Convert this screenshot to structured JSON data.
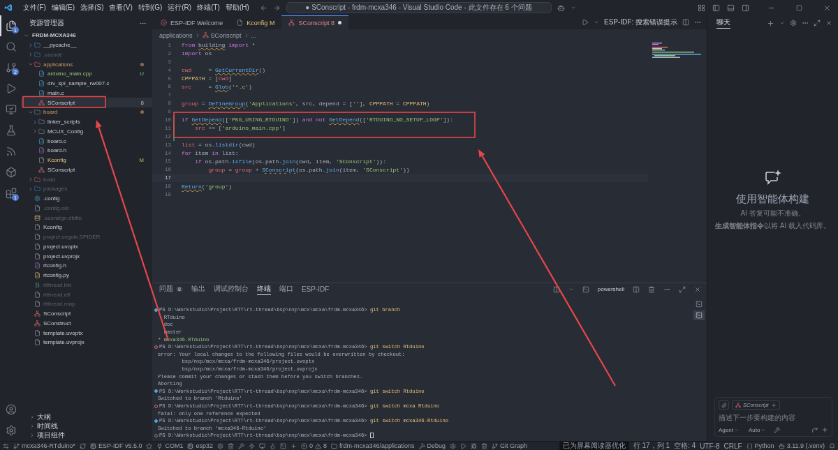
{
  "menu": [
    "文件(F)",
    "编辑(E)",
    "选择(S)",
    "查看(V)",
    "转到(G)",
    "运行(R)",
    "终端(T)",
    "帮助(H)"
  ],
  "command_center": "● SConscript - frdm-mcxa346 - Visual Studio Code - 此文件存在 6 个问题",
  "activity_bar": {
    "items": [
      {
        "kind": "explorer",
        "selected": true,
        "badge": "1"
      },
      {
        "kind": "search",
        "selected": false
      },
      {
        "kind": "source-control",
        "selected": false,
        "badge": "2"
      },
      {
        "kind": "run",
        "selected": false
      },
      {
        "kind": "remote",
        "selected": false
      },
      {
        "kind": "testing",
        "selected": false
      },
      {
        "kind": "esp-idf",
        "selected": false
      },
      {
        "kind": "package",
        "selected": false
      },
      {
        "kind": "extensions",
        "selected": false,
        "badge": "1"
      }
    ],
    "bottom": [
      {
        "kind": "account"
      },
      {
        "kind": "settings"
      }
    ]
  },
  "explorer": {
    "title": "资源管理器",
    "root": {
      "label": "FRDM-MCXA346",
      "expanded": true,
      "children": [
        {
          "label": "__pycache__",
          "kind": "folder-py",
          "expanded": false,
          "selected": false
        },
        {
          "label": ".vscode",
          "kind": "folder-vscode",
          "expanded": false,
          "dimmed": true,
          "selected": false
        },
        {
          "label": "applications",
          "kind": "folder-app",
          "expanded": true,
          "modified": true,
          "dot": true,
          "selected": false,
          "children": [
            {
              "label": "arduino_main.cpp",
              "kind": "cpp",
              "untracked": true,
              "badge": "U",
              "selected": false
            },
            {
              "label": "drv_spi_sample_rw007.c",
              "kind": "c",
              "selected": false
            },
            {
              "label": "main.c",
              "kind": "c",
              "selected": false
            },
            {
              "label": "SConscript",
              "kind": "scons",
              "badge": "8",
              "selected": true
            }
          ]
        },
        {
          "label": "board",
          "kind": "folder",
          "expanded": true,
          "modified": true,
          "dot": true,
          "selected": false,
          "children": [
            {
              "label": "linker_scripts",
              "kind": "folder",
              "expanded": false,
              "selected": false
            },
            {
              "label": "MCUX_Config",
              "kind": "folder",
              "expanded": false,
              "selected": false
            },
            {
              "label": "board.c",
              "kind": "c",
              "selected": false
            },
            {
              "label": "board.h",
              "kind": "h",
              "selected": false
            },
            {
              "label": "Kconfig",
              "kind": "file",
              "modified": true,
              "badge": "M",
              "selected": false
            },
            {
              "label": "SConscript",
              "kind": "scons",
              "selected": false
            }
          ]
        },
        {
          "label": "build",
          "kind": "folder-build",
          "expanded": false,
          "dimmed": true,
          "selected": false
        },
        {
          "label": "packages",
          "kind": "folder-packages",
          "expanded": false,
          "dimmed": true,
          "selected": false
        },
        {
          "label": ".config",
          "kind": "gear",
          "selected": false
        },
        {
          "label": ".config.old",
          "kind": "file",
          "dimmed": true,
          "selected": false
        },
        {
          "label": ".sconsign.dblite",
          "kind": "db",
          "dimmed": true,
          "selected": false
        },
        {
          "label": "Kconfig",
          "kind": "file",
          "selected": false
        },
        {
          "label": "project.uvguix.SPIDER",
          "kind": "file",
          "dimmed": true,
          "selected": false
        },
        {
          "label": "project.uvoptx",
          "kind": "file",
          "selected": false
        },
        {
          "label": "project.uvprojx",
          "kind": "file",
          "selected": false
        },
        {
          "label": "rtconfig.h",
          "kind": "h",
          "selected": false
        },
        {
          "label": "rtconfig.py",
          "kind": "py",
          "selected": false
        },
        {
          "label": "rtthread.bin",
          "kind": "bin",
          "dimmed": true,
          "selected": false
        },
        {
          "label": "rtthread.elf",
          "kind": "file",
          "dimmed": true,
          "selected": false
        },
        {
          "label": "rtthread.map",
          "kind": "file",
          "dimmed": true,
          "selected": false
        },
        {
          "label": "SConscript",
          "kind": "scons",
          "selected": false
        },
        {
          "label": "SConstruct",
          "kind": "scons",
          "selected": false
        },
        {
          "label": "template.uvoptx",
          "kind": "file",
          "selected": false
        },
        {
          "label": "template.uvprojx",
          "kind": "file",
          "selected": false
        }
      ]
    },
    "sections": [
      {
        "label": "大纲",
        "expanded": false
      },
      {
        "label": "时间线",
        "expanded": false
      },
      {
        "label": "项目组件",
        "expanded": false
      }
    ]
  },
  "editor": {
    "tabs": [
      {
        "label": "ESP-IDF Welcome",
        "kind": "esp",
        "selected": false,
        "dirty": false
      },
      {
        "label": "Kconfig",
        "kind": "file",
        "modified": true,
        "badge": "M",
        "selected": false,
        "dirty": false
      },
      {
        "label": "SConscript",
        "kind": "scons",
        "has_errors": true,
        "badge": "8",
        "selected": true,
        "dirty": true
      }
    ],
    "search_hint": "ESP-IDF: 搜索错误提示",
    "breadcrumb": [
      "applications",
      "SConscript",
      "..."
    ],
    "lines": [
      {
        "n": "1",
        "tokens": [
          {
            "kind": "k",
            "text": "from "
          },
          {
            "kind": "pw",
            "text": "building"
          },
          {
            "kind": "k",
            "text": " import"
          },
          {
            "kind": "p",
            "text": " *"
          }
        ]
      },
      {
        "n": "2",
        "tokens": [
          {
            "kind": "k",
            "text": "import"
          },
          {
            "kind": "p",
            "text": " os"
          }
        ]
      },
      {
        "n": "3"
      },
      {
        "n": "4",
        "tokens": [
          {
            "kind": "v",
            "text": "cwd"
          },
          {
            "kind": "p",
            "text": "     = "
          },
          {
            "kind": "fw",
            "text": "GetCurrentDir"
          },
          {
            "kind": "p",
            "text": "()"
          }
        ]
      },
      {
        "n": "5",
        "tokens": [
          {
            "kind": "c",
            "text": "CPPPATH"
          },
          {
            "kind": "p",
            "text": " = ["
          },
          {
            "kind": "v",
            "text": "cwd"
          },
          {
            "kind": "p",
            "text": "]"
          }
        ]
      },
      {
        "n": "6",
        "tokens": [
          {
            "kind": "v",
            "text": "src"
          },
          {
            "kind": "p",
            "text": "     = "
          },
          {
            "kind": "fw",
            "text": "Glob"
          },
          {
            "kind": "p",
            "text": "("
          },
          {
            "kind": "s",
            "text": "'*.c'"
          },
          {
            "kind": "p",
            "text": ")"
          }
        ]
      },
      {
        "n": "7"
      },
      {
        "n": "8",
        "tokens": [
          {
            "kind": "v",
            "text": "group"
          },
          {
            "kind": "p",
            "text": " = "
          },
          {
            "kind": "fw",
            "text": "DefineGroup"
          },
          {
            "kind": "p",
            "text": "("
          },
          {
            "kind": "s",
            "text": "'Applications'"
          },
          {
            "kind": "p",
            "text": ", src, depend = ["
          },
          {
            "kind": "s",
            "text": "''"
          },
          {
            "kind": "p",
            "text": "], "
          },
          {
            "kind": "c",
            "text": "CPPPATH"
          },
          {
            "kind": "p",
            "text": " = "
          },
          {
            "kind": "c",
            "text": "CPPPATH"
          },
          {
            "kind": "p",
            "text": ")"
          }
        ]
      },
      {
        "n": "9"
      },
      {
        "n": "10",
        "changed": true,
        "tokens": [
          {
            "kind": "k",
            "text": "if "
          },
          {
            "kind": "fw",
            "text": "GetDepend"
          },
          {
            "kind": "p",
            "text": "(["
          },
          {
            "kind": "s",
            "text": "'PKG_USING_RTDUINO'"
          },
          {
            "kind": "p",
            "text": "]) "
          },
          {
            "kind": "k",
            "text": "and not "
          },
          {
            "kind": "fw",
            "text": "GetDepend"
          },
          {
            "kind": "p",
            "text": "(["
          },
          {
            "kind": "s",
            "text": "'RTDUINO_NO_SETUP_LOOP'"
          },
          {
            "kind": "p",
            "text": "]):"
          }
        ]
      },
      {
        "n": "11",
        "changed": true,
        "tokens": [
          {
            "kind": "v",
            "text": "    src"
          },
          {
            "kind": "p",
            "text": " += ["
          },
          {
            "kind": "s",
            "text": "'arduino_main.cpp'"
          },
          {
            "kind": "p",
            "text": "]"
          }
        ]
      },
      {
        "n": "12",
        "changed": true
      },
      {
        "n": "13",
        "tokens": [
          {
            "kind": "v",
            "text": "list"
          },
          {
            "kind": "p",
            "text": " = os."
          },
          {
            "kind": "f",
            "text": "listdir"
          },
          {
            "kind": "p",
            "text": "(cwd)"
          }
        ]
      },
      {
        "n": "14",
        "tokens": [
          {
            "kind": "k",
            "text": "for"
          },
          {
            "kind": "p",
            "text": " item "
          },
          {
            "kind": "k",
            "text": "in"
          },
          {
            "kind": "p",
            "text": " list:"
          }
        ]
      },
      {
        "n": "15",
        "tokens": [
          {
            "kind": "k",
            "text": "    if"
          },
          {
            "kind": "p",
            "text": " os.path."
          },
          {
            "kind": "f",
            "text": "isfile"
          },
          {
            "kind": "p",
            "text": "(os.path."
          },
          {
            "kind": "f",
            "text": "join"
          },
          {
            "kind": "p",
            "text": "(cwd, item, "
          },
          {
            "kind": "s",
            "text": "'SConscript'"
          },
          {
            "kind": "p",
            "text": ")):"
          }
        ]
      },
      {
        "n": "16",
        "tokens": [
          {
            "kind": "v",
            "text": "        group"
          },
          {
            "kind": "p",
            "text": " = "
          },
          {
            "kind": "v",
            "text": "group"
          },
          {
            "kind": "p",
            "text": " + "
          },
          {
            "kind": "fw",
            "text": "SConscript"
          },
          {
            "kind": "p",
            "text": "(os.path."
          },
          {
            "kind": "f",
            "text": "join"
          },
          {
            "kind": "p",
            "text": "(item, "
          },
          {
            "kind": "s",
            "text": "'SConscript'"
          },
          {
            "kind": "p",
            "text": "))"
          }
        ]
      },
      {
        "n": "17",
        "current": true
      },
      {
        "n": "18",
        "tokens": [
          {
            "kind": "fw",
            "text": "Return"
          },
          {
            "kind": "p",
            "text": "("
          },
          {
            "kind": "s",
            "text": "'group'"
          },
          {
            "kind": "p",
            "text": ")"
          }
        ]
      },
      {
        "n": "19"
      }
    ]
  },
  "panel": {
    "tabs": [
      {
        "label": "问题",
        "badge": "8",
        "selected": false
      },
      {
        "label": "输出",
        "selected": false
      },
      {
        "label": "调试控制台",
        "selected": false
      },
      {
        "label": "终端",
        "selected": true
      },
      {
        "label": "端口",
        "selected": false
      },
      {
        "label": "ESP-IDF",
        "selected": false
      }
    ],
    "shell": "powershell",
    "sessions": [
      {
        "selected": false
      },
      {
        "selected": true
      }
    ],
    "terminal": [
      {
        "kind": "prompt-ok",
        "path": "PS D:\\Workstudio\\Project\\RTT\\rt-thread\\bsp\\nxp\\mcx\\mcxa\\frdm-mcxa346>",
        "cmd": "git branch"
      },
      {
        "kind": "output",
        "text": "  RTduino"
      },
      {
        "kind": "output",
        "text": "  doc"
      },
      {
        "kind": "output",
        "text": "  master"
      },
      {
        "kind": "branch",
        "mark": "*",
        "text": "mcxa346-RTduino"
      },
      {
        "kind": "prompt-error",
        "path": "PS D:\\Workstudio\\Project\\RTT\\rt-thread\\bsp\\nxp\\mcx\\mcxa\\frdm-mcxa346>",
        "cmd": "git switch Rtduino"
      },
      {
        "kind": "output",
        "text": "error: Your local changes to the following files would be overwritten by checkout:"
      },
      {
        "kind": "output",
        "text": "        bsp/nxp/mcx/mcxa/frdm-mcxa346/project.uvoptx"
      },
      {
        "kind": "output",
        "text": "        bsp/nxp/mcx/mcxa/frdm-mcxa346/project.uvprojx"
      },
      {
        "kind": "output",
        "text": "Please commit your changes or stash them before you switch branches."
      },
      {
        "kind": "output",
        "text": "Aborting"
      },
      {
        "kind": "prompt-ok",
        "path": "PS D:\\Workstudio\\Project\\RTT\\rt-thread\\bsp\\nxp\\mcx\\mcxa\\frdm-mcxa346>",
        "cmd": "git switch Rtduino"
      },
      {
        "kind": "output",
        "text": "Switched to branch 'Rtduino'"
      },
      {
        "kind": "prompt-error",
        "path": "PS D:\\Workstudio\\Project\\RTT\\rt-thread\\bsp\\nxp\\mcx\\mcxa\\frdm-mcxa346>",
        "cmd": "git switch mcxa Rtduino"
      },
      {
        "kind": "output",
        "text": "fatal: only one reference expected"
      },
      {
        "kind": "prompt-ok",
        "path": "PS D:\\Workstudio\\Project\\RTT\\rt-thread\\bsp\\nxp\\mcx\\mcxa\\frdm-mcxa346>",
        "cmd": "git switch mcxa346-Rtduino"
      },
      {
        "kind": "output",
        "text": "Switched to branch 'mcxa346-Rtduino'"
      },
      {
        "kind": "prompt",
        "path": "PS D:\\Workstudio\\Project\\RTT\\rt-thread\\bsp\\nxp\\mcx\\mcxa\\frdm-mcxa346>",
        "cursor": true
      }
    ]
  },
  "chat": {
    "tabs": [
      {
        "label": "聊天",
        "selected": true
      }
    ],
    "heading": "使用智能体构建",
    "disclaimer": "AI 答复可能不准确。",
    "hint": "**生成智能体指令**以将 AI 载入代码库。",
    "input": {
      "context_chip": "SConscript",
      "placeholder": "描述下一步要构建的内容",
      "mode": "Agent",
      "model": "Auto"
    }
  },
  "status_bar": {
    "left": [
      {
        "kind": "remote"
      },
      {
        "kind": "branch",
        "text": "mcxa346-RTduino*"
      },
      {
        "kind": "sync"
      },
      {
        "kind": "esp-idf",
        "text": "ESP-IDF v5.5.0"
      },
      {
        "kind": "star"
      },
      {
        "kind": "port",
        "text": "COM1"
      },
      {
        "kind": "target",
        "text": "esp32"
      },
      {
        "kind": "gear"
      },
      {
        "kind": "trash"
      },
      {
        "kind": "wrench"
      },
      {
        "kind": "flash"
      },
      {
        "kind": "monitor"
      },
      {
        "kind": "flame"
      },
      {
        "kind": "terminal"
      },
      {
        "kind": "plus"
      },
      {
        "kind": "problems",
        "errors": "0",
        "warnings": "8"
      },
      {
        "kind": "folder",
        "text": "frdm-mcxa346/applications"
      },
      {
        "kind": "debug",
        "text": "Debug"
      },
      {
        "kind": "gear"
      },
      {
        "kind": "run"
      },
      {
        "kind": "bug"
      },
      {
        "kind": "trash"
      },
      {
        "kind": "git-graph",
        "text": "Git Graph"
      }
    ],
    "right": [
      {
        "kind": "accessibility",
        "text": "已为屏幕阅读器优化"
      },
      {
        "kind": "text",
        "text": "行 17，列 1"
      },
      {
        "kind": "text",
        "text": "空格: 4"
      },
      {
        "kind": "text",
        "text": "UTF-8"
      },
      {
        "kind": "text",
        "text": "CRLF"
      },
      {
        "kind": "language",
        "text": "Python"
      },
      {
        "kind": "python",
        "text": "3.11.9 (.venv)"
      },
      {
        "kind": "bell"
      }
    ]
  }
}
